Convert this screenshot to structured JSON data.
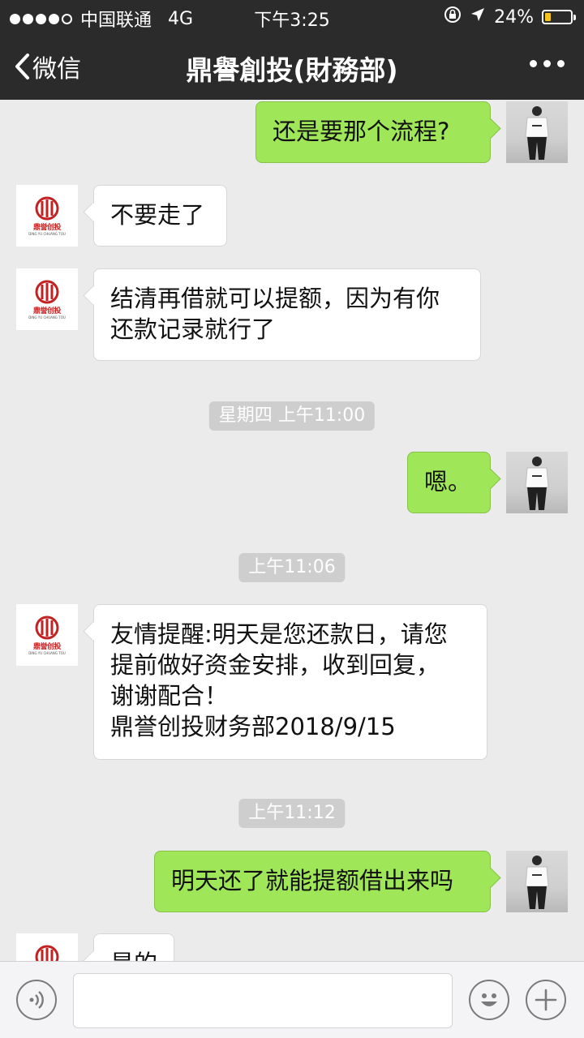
{
  "status_bar": {
    "carrier": "中国联通",
    "network": "4G",
    "time": "下午3:25",
    "battery": "24%",
    "battery_level": 0.24,
    "battery_color": "#f6c21c"
  },
  "nav": {
    "back_label": "微信",
    "title": "鼎譽創投(財務部)"
  },
  "logo": {
    "text": "鼎誉创投",
    "sub": "DING YU CHUANG TOU"
  },
  "messages": [
    {
      "type": "text",
      "from": "me",
      "text": "还是要那个流程?"
    },
    {
      "type": "text",
      "from": "them",
      "text": "不要走了"
    },
    {
      "type": "text",
      "from": "them",
      "lines": [
        "结清再借就可以提额，因为有你",
        "还款记录就行了"
      ]
    },
    {
      "type": "time",
      "text": "星期四 上午11:00"
    },
    {
      "type": "text",
      "from": "me",
      "text": "嗯。"
    },
    {
      "type": "time",
      "text": "上午11:06"
    },
    {
      "type": "text",
      "from": "them",
      "lines": [
        "友情提醒:明天是您还款日，请您",
        "提前做好资金安排，收到回复，",
        "谢谢配合！",
        "鼎誉创投财务部2018/9/15"
      ]
    },
    {
      "type": "time",
      "text": "上午11:12"
    },
    {
      "type": "text",
      "from": "me",
      "text": "明天还了就能提额借出来吗"
    },
    {
      "type": "text",
      "from": "them",
      "text": "是的"
    }
  ],
  "input": {
    "value": "",
    "placeholder": ""
  },
  "colors": {
    "header": "#2b2b2b",
    "chat_bg": "#ebebeb",
    "out_bubble": "#9fe658",
    "in_bubble": "#ffffff",
    "logo_red": "#c22222"
  },
  "icons": {
    "back": "chevron-left-icon",
    "more": "more-dots-icon",
    "voice": "voice-icon",
    "emoji": "emoji-icon",
    "add": "plus-icon",
    "location": "location-arrow-icon",
    "lock": "orientation-lock-icon"
  }
}
